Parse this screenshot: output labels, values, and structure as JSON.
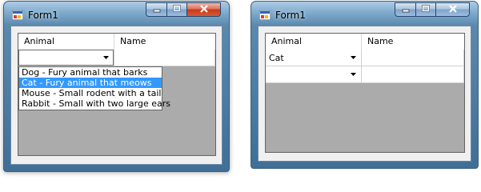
{
  "windows": [
    {
      "title": "Form1",
      "columns": [
        "Animal",
        "Name"
      ],
      "rows": [
        {
          "animal": "",
          "name": ""
        }
      ],
      "dropdown_options": [
        "Dog - Fury animal that barks",
        "Cat - Fury animal that meows",
        "Mouse - Small rodent with a tail",
        "Rabbit - Small with two large ears"
      ],
      "selected_option_index": 1
    },
    {
      "title": "Form1",
      "columns": [
        "Animal",
        "Name"
      ],
      "rows": [
        {
          "animal": "Cat",
          "name": ""
        },
        {
          "animal": "",
          "name": ""
        }
      ]
    }
  ],
  "icons": {
    "app": "form-app-icon",
    "minimize": "minimize-icon",
    "maximize": "maximize-icon",
    "close": "close-icon",
    "dropdown": "chevron-down-icon"
  },
  "colors": {
    "selection": "#3399ff",
    "grid_background": "#ababab",
    "close_button": "#c53a1c"
  }
}
